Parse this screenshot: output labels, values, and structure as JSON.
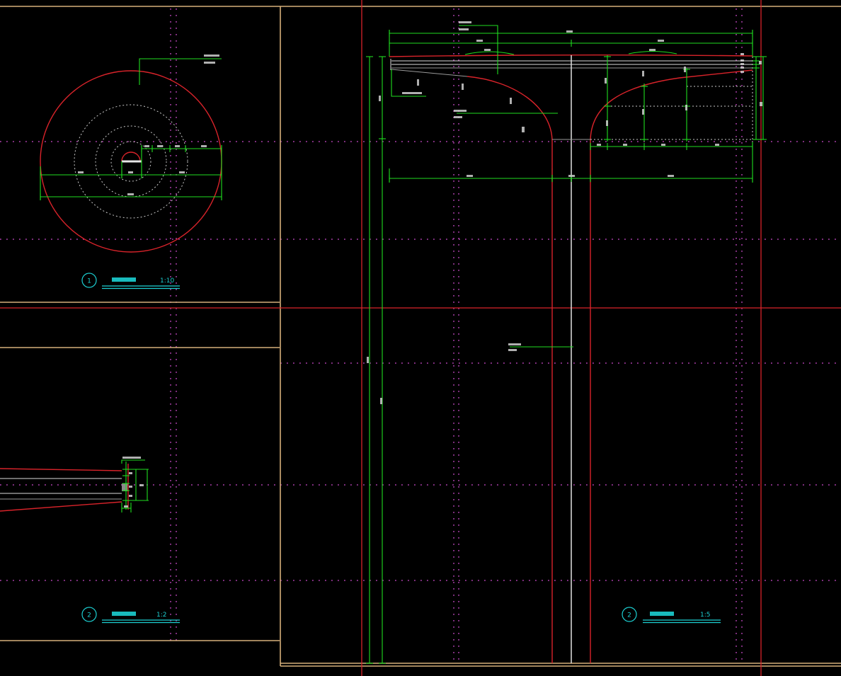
{
  "drawing": {
    "colors": {
      "background": "#000000",
      "frame": "#d6b07a",
      "view_boundary": "#d8232a",
      "dimension": "#1fdc1f",
      "geometry_red": "#d8232a",
      "geometry_white": "#dcdcdc",
      "grid": "#9c3a9c",
      "annotation": "#1ccfd2"
    },
    "details": [
      {
        "number": "1",
        "scale": "1:10"
      },
      {
        "number": "2",
        "scale": "1:2"
      },
      {
        "number": "2",
        "scale": "1:5"
      }
    ]
  }
}
